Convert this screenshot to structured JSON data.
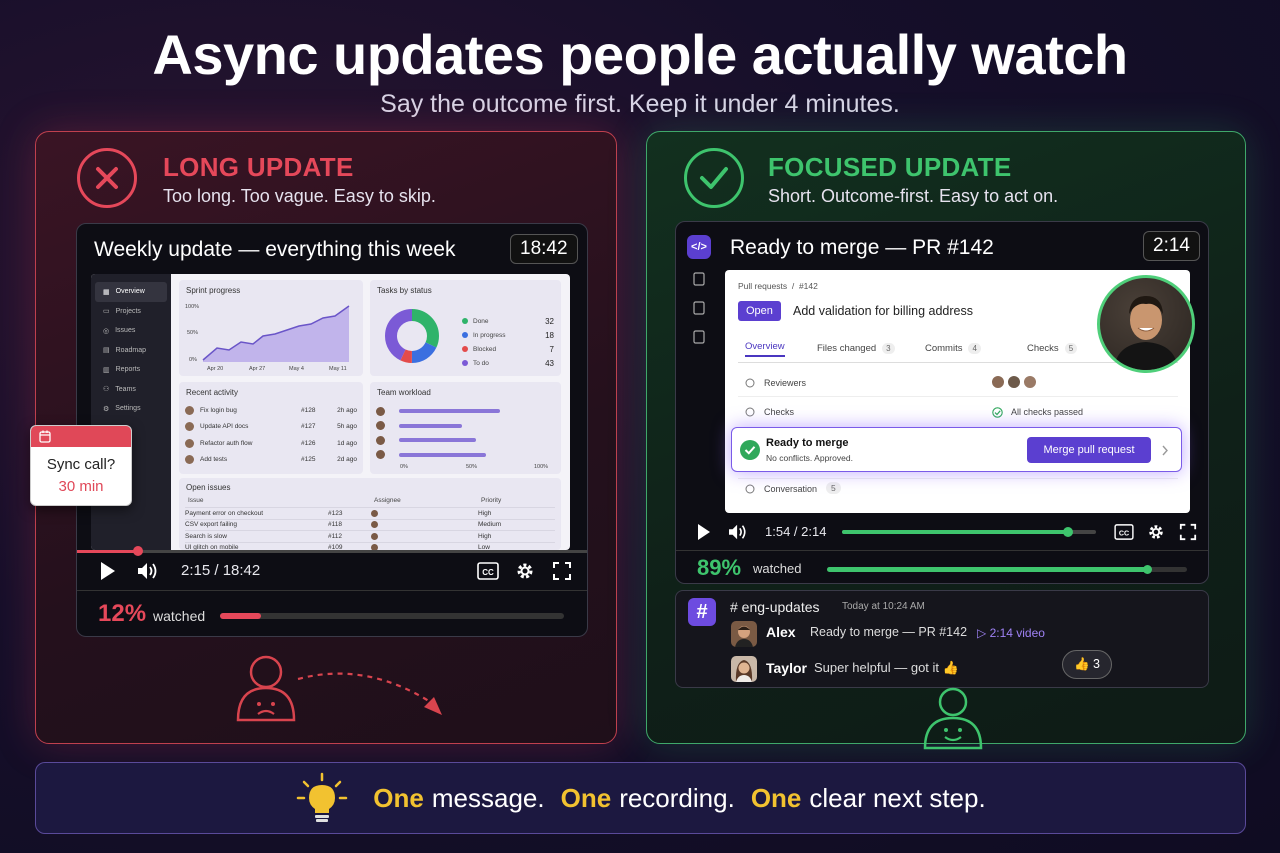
{
  "title": "Async updates people actually watch",
  "subtitle": "Say the outcome first. Keep it under 4 minutes.",
  "colors": {
    "red": "#e5485a",
    "green": "#3ec46d",
    "yellow": "#f2c230",
    "purple": "#6d4be0"
  },
  "left": {
    "heading": "LONG UPDATE",
    "sub": "Too long. Too vague. Easy to skip.",
    "video_title": "Weekly update — everything this week",
    "duration": "18:42",
    "app": {
      "nav": [
        "Overview",
        "Projects",
        "Issues",
        "Roadmap",
        "Reports",
        "Teams",
        "Settings"
      ],
      "sprint": {
        "title": "Sprint progress",
        "y_ticks": [
          "100%",
          "50%",
          "0%"
        ],
        "x_ticks": [
          "Apr 20",
          "Apr 27",
          "May 4",
          "May 11"
        ]
      },
      "tasks": {
        "title": "Tasks by status",
        "items": [
          {
            "label": "Done",
            "value": "32",
            "color": "#2fb36a",
            "share": 0.32
          },
          {
            "label": "In progress",
            "value": "18",
            "color": "#3b6fe0",
            "share": 0.18
          },
          {
            "label": "Blocked",
            "value": "7",
            "color": "#e34b4b",
            "share": 0.07
          },
          {
            "label": "To do",
            "value": "43",
            "color": "#7b5ad6",
            "share": 0.43
          }
        ]
      },
      "activity": {
        "title": "Recent activity",
        "rows": [
          {
            "text": "Fix login bug",
            "id": "#128",
            "time": "2h ago"
          },
          {
            "text": "Update API docs",
            "id": "#127",
            "time": "5h ago"
          },
          {
            "text": "Refactor auth flow",
            "id": "#126",
            "time": "1d ago"
          },
          {
            "text": "Add tests",
            "id": "#125",
            "time": "2d ago"
          }
        ]
      },
      "workload": {
        "title": "Team workload",
        "ticks": [
          "0%",
          "50%",
          "100%"
        ],
        "levels": [
          0.72,
          0.45,
          0.55,
          0.62
        ]
      },
      "issues": {
        "title": "Open issues",
        "headers": [
          "Issue",
          "Assignee",
          "Priority"
        ],
        "rows": [
          {
            "text": "Payment error on checkout",
            "id": "#123",
            "priority": "High"
          },
          {
            "text": "CSV export failing",
            "id": "#118",
            "priority": "Medium"
          },
          {
            "text": "Search is slow",
            "id": "#112",
            "priority": "High"
          },
          {
            "text": "UI glitch on mobile",
            "id": "#109",
            "priority": "Low"
          }
        ]
      }
    },
    "sync": {
      "title": "Sync call?",
      "time": "30 min"
    },
    "playback": "2:15 / 18:42",
    "progress": 0.12,
    "watched_pct": "12%",
    "watched_label": "watched"
  },
  "right": {
    "heading": "FOCUSED UPDATE",
    "sub": "Short. Outcome-first. Easy to act on.",
    "video_title": "Ready to merge — PR #142",
    "duration": "2:14",
    "pr": {
      "breadcrumb": "Pull requests  /  #142",
      "status": "Open",
      "title": "Add validation for billing address",
      "tabs": [
        {
          "label": "Overview",
          "count": ""
        },
        {
          "label": "Files changed",
          "count": "3"
        },
        {
          "label": "Commits",
          "count": "4"
        },
        {
          "label": "Checks",
          "count": "5"
        }
      ],
      "reviewers_label": "Reviewers",
      "checks_label": "Checks",
      "checks_value": "All checks passed",
      "merge_title": "Ready to merge",
      "merge_sub": "No conflicts. Approved.",
      "merge_button": "Merge pull request",
      "conversation_label": "Conversation",
      "conversation_count": "5"
    },
    "playback": "1:54 / 2:14",
    "progress": 0.89,
    "watched_pct": "89%",
    "watched_label": "watched",
    "chat": {
      "channel": "# eng-updates",
      "timestamp": "Today at 10:24 AM",
      "messages": [
        {
          "user": "Alex",
          "text": "Ready to merge — PR #142",
          "link": "▷ 2:14 video"
        },
        {
          "user": "Taylor",
          "text": "Super helpful — got it 👍",
          "reaction": "👍 3"
        }
      ]
    }
  },
  "banner": {
    "w1": "One",
    "t1": "message.",
    "w2": "One",
    "t2": "recording.",
    "w3": "One",
    "t3": "clear next step."
  }
}
